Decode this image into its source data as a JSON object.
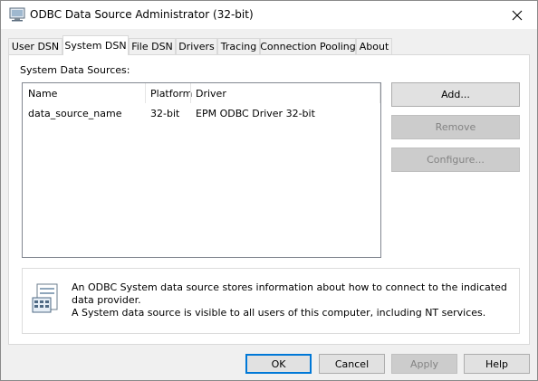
{
  "window": {
    "title": "ODBC Data Source Administrator (32-bit)",
    "close_glyph": "✕"
  },
  "tabs": [
    {
      "label": "User DSN",
      "active": false
    },
    {
      "label": "System DSN",
      "active": true
    },
    {
      "label": "File DSN",
      "active": false
    },
    {
      "label": "Drivers",
      "active": false
    },
    {
      "label": "Tracing",
      "active": false
    },
    {
      "label": "Connection Pooling",
      "active": false
    },
    {
      "label": "About",
      "active": false
    }
  ],
  "system_dsn": {
    "group_label": "System Data Sources:",
    "columns": [
      "Name",
      "Platform",
      "Driver"
    ],
    "rows": [
      {
        "name": "data_source_name",
        "platform": "32-bit",
        "driver": "EPM ODBC Driver 32-bit"
      }
    ],
    "buttons": {
      "add": "Add...",
      "remove": "Remove",
      "configure": "Configure..."
    },
    "info_text": [
      "An ODBC System data source stores information about how to connect to the indicated data provider.",
      "A System data source is visible to all users of this computer, including NT services."
    ]
  },
  "footer": {
    "ok": "OK",
    "cancel": "Cancel",
    "apply": "Apply",
    "help": "Help"
  }
}
